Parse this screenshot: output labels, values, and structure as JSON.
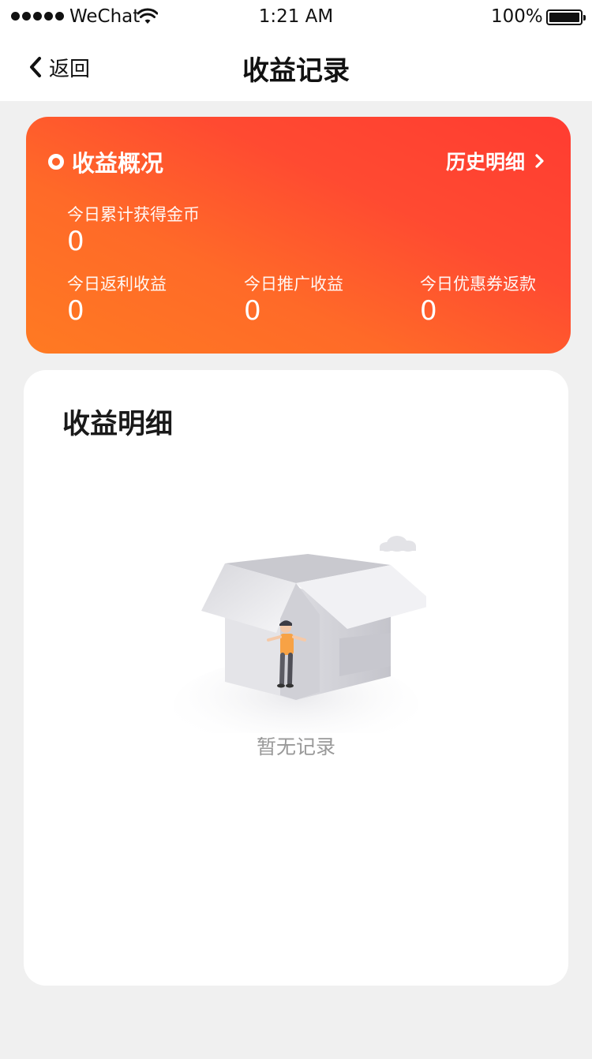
{
  "status_bar": {
    "carrier": "WeChat",
    "time": "1:21 AM",
    "battery": "100%",
    "battery_level": 1.0
  },
  "nav": {
    "back_label": "返回",
    "title": "收益记录"
  },
  "summary": {
    "title": "收益概况",
    "history_link": "历史明细",
    "stats": [
      {
        "label": "今日累计获得金币",
        "value": "0"
      },
      {
        "label": "今日返利收益",
        "value": "0"
      },
      {
        "label": "今日推广收益",
        "value": "0"
      },
      {
        "label": "今日优惠券返款",
        "value": "0"
      }
    ],
    "gradient_colors": [
      "#ff7a22",
      "#ff3c31"
    ]
  },
  "detail": {
    "title": "收益明细",
    "empty_text": "暂无记录",
    "empty_icon": "empty-box-illustration"
  }
}
